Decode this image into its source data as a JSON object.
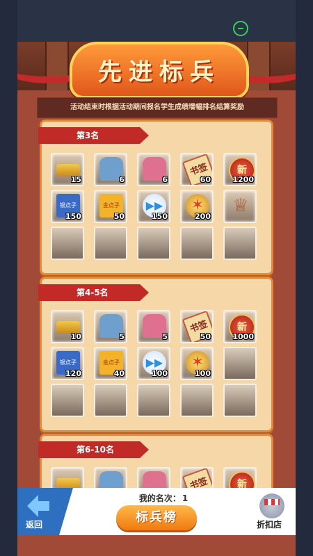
{
  "title": "先进标兵",
  "subtitle": "活动结束时根据活动期间报名学生成绩增幅排名结算奖励",
  "tiers": [
    {
      "label": "第3名",
      "rewards": [
        {
          "icon": "gold-book-icon",
          "qty": "15"
        },
        {
          "icon": "blue-backpack-icon",
          "qty": "6"
        },
        {
          "icon": "pink-backpack-icon",
          "qty": "6"
        },
        {
          "icon": "book-tag-icon",
          "qty": "60"
        },
        {
          "icon": "red-coin-icon",
          "qty": "1200"
        },
        {
          "icon": "blue-ticket-icon",
          "qty": "150"
        },
        {
          "icon": "gold-ticket-icon",
          "qty": "50"
        },
        {
          "icon": "fast-forward-icon",
          "qty": "150"
        },
        {
          "icon": "flame-medal-icon",
          "qty": "200"
        },
        {
          "icon": "trophy-icon",
          "qty": ""
        }
      ]
    },
    {
      "label": "第4-5名",
      "rewards": [
        {
          "icon": "gold-book-icon",
          "qty": "10"
        },
        {
          "icon": "blue-backpack-icon",
          "qty": "5"
        },
        {
          "icon": "pink-backpack-icon",
          "qty": "5"
        },
        {
          "icon": "book-tag-icon",
          "qty": "50"
        },
        {
          "icon": "red-coin-icon",
          "qty": "1000"
        },
        {
          "icon": "blue-ticket-icon",
          "qty": "120"
        },
        {
          "icon": "gold-ticket-icon",
          "qty": "40"
        },
        {
          "icon": "fast-forward-icon",
          "qty": "100"
        },
        {
          "icon": "flame-medal-icon",
          "qty": "100"
        }
      ]
    },
    {
      "label": "第6-10名",
      "rewards": [
        {
          "icon": "gold-book-icon",
          "qty": ""
        },
        {
          "icon": "blue-backpack-icon",
          "qty": ""
        },
        {
          "icon": "pink-backpack-icon",
          "qty": ""
        },
        {
          "icon": "book-tag-icon",
          "qty": ""
        },
        {
          "icon": "red-coin-icon",
          "qty": ""
        }
      ]
    }
  ],
  "icon_glyphs": {
    "tag_text": "书签",
    "coin_text": "新",
    "blue_ticket_text": "银点子",
    "gold_ticket_text": "金点子"
  },
  "bottom": {
    "back_label": "返回",
    "my_rank_label": "我的名次：",
    "my_rank_value": "1",
    "board_label": "标兵榜",
    "shop_label": "折扣店"
  }
}
